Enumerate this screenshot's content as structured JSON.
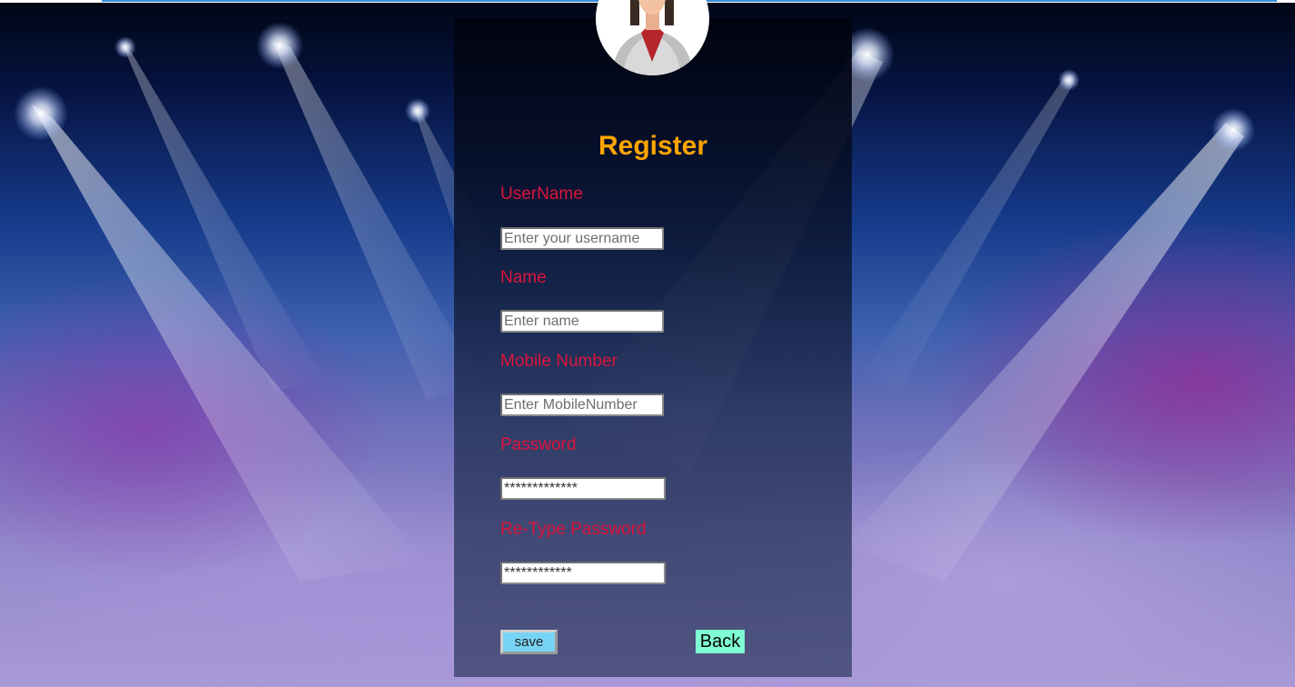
{
  "form": {
    "title": "Register",
    "fields": [
      {
        "label": "UserName",
        "placeholder": "Enter your username",
        "value": ""
      },
      {
        "label": "Name",
        "placeholder": "Enter name",
        "value": ""
      },
      {
        "label": "Mobile Number",
        "placeholder": "Enter MobileNumber",
        "value": ""
      },
      {
        "label": "Password",
        "placeholder": "",
        "value": "*************"
      },
      {
        "label": "Re-Type Password",
        "placeholder": "",
        "value": "************"
      }
    ],
    "save_label": "save",
    "back_label": "Back"
  },
  "avatar": {
    "icon": "businesswoman-avatar-icon"
  },
  "colors": {
    "title": "#ffa500",
    "label": "#dc143c",
    "save_button": "#78d4f5",
    "back_button": "#7fffd4"
  }
}
